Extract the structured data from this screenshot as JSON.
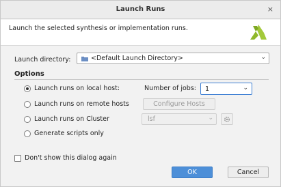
{
  "window": {
    "title": "Launch Runs",
    "close_glyph": "×"
  },
  "header": {
    "description": "Launch the selected synthesis or implementation runs.",
    "logo_icon": "xilinx-logo"
  },
  "launch_directory": {
    "label": "Launch directory:",
    "value": "<Default Launch Directory>",
    "icon": "folder-icon"
  },
  "options": {
    "title": "Options",
    "radios": [
      {
        "label": "Launch runs on local host:",
        "selected": true
      },
      {
        "label": "Launch runs on remote hosts",
        "selected": false
      },
      {
        "label": "Launch runs on Cluster",
        "selected": false
      },
      {
        "label": "Generate scripts only",
        "selected": false
      }
    ],
    "jobs": {
      "label": "Number of jobs:",
      "value": "1"
    },
    "configure_hosts_label": "Configure Hosts",
    "cluster": {
      "value": "lsf",
      "settings_icon": "gear-icon"
    }
  },
  "dont_show": {
    "label": "Don't show this dialog again",
    "checked": false
  },
  "buttons": {
    "ok": "OK",
    "cancel": "Cancel"
  },
  "colors": {
    "accent": "#4d8fd8",
    "focus_border": "#3d7fd3",
    "logo": "#8fb82a"
  }
}
